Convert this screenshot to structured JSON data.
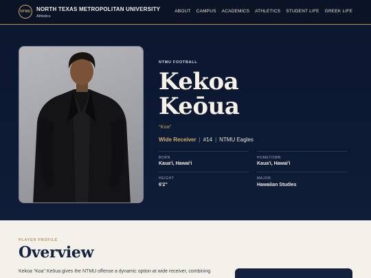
{
  "header": {
    "logo_text": "NTMU",
    "university": "NORTH TEXAS METROPOLITAN UNIVERSITY",
    "department": "Athletics",
    "nav": [
      "ABOUT",
      "CAMPUS",
      "ACADEMICS",
      "ATHLETICS",
      "STUDENT LIFE",
      "GREEK LIFE"
    ]
  },
  "hero": {
    "eyebrow": "NTMU FOOTBALL",
    "first_name": "Kekoa",
    "last_name": "Keōua",
    "nickname": "“Koa”",
    "position": "Wide Receiver",
    "number": "#14",
    "team": "NTMU Eagles",
    "separator": "|",
    "facts": [
      {
        "label": "BORN",
        "value": "Kaua'i, Hawai'i"
      },
      {
        "label": "HOMETOWN",
        "value": "Kaua'i, Hawai'i"
      },
      {
        "label": "HEIGHT",
        "value": "6'2\""
      },
      {
        "label": "MAJOR",
        "value": "Hawaiian Studies"
      }
    ]
  },
  "overview": {
    "eyebrow": "PLAYER PROFILE",
    "title": "Overview",
    "text": "Kekoa “Koa” Keōua gives the NTMU offense a dynamic option at wide receiver, combining"
  },
  "colors": {
    "navy": "#0c1730",
    "gold": "#c9a36a",
    "cream": "#f4f1ea"
  }
}
